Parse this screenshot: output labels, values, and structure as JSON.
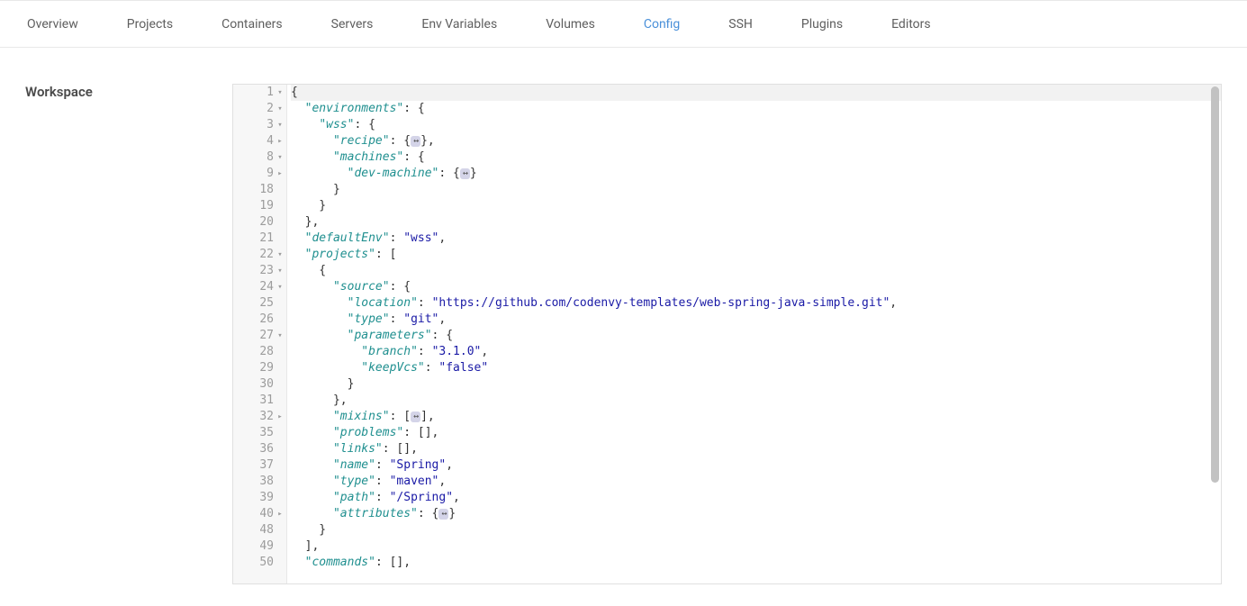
{
  "tabs": {
    "items": [
      {
        "label": "Overview",
        "active": false
      },
      {
        "label": "Projects",
        "active": false
      },
      {
        "label": "Containers",
        "active": false
      },
      {
        "label": "Servers",
        "active": false
      },
      {
        "label": "Env Variables",
        "active": false
      },
      {
        "label": "Volumes",
        "active": false
      },
      {
        "label": "Config",
        "active": true
      },
      {
        "label": "SSH",
        "active": false
      },
      {
        "label": "Plugins",
        "active": false
      },
      {
        "label": "Editors",
        "active": false
      }
    ]
  },
  "sidebar": {
    "section_label": "Workspace"
  },
  "editor": {
    "gutter": [
      {
        "n": "1",
        "fold": "▾"
      },
      {
        "n": "2",
        "fold": "▾"
      },
      {
        "n": "3",
        "fold": "▾"
      },
      {
        "n": "4",
        "fold": "▸"
      },
      {
        "n": "8",
        "fold": "▾"
      },
      {
        "n": "9",
        "fold": "▸"
      },
      {
        "n": "18",
        "fold": ""
      },
      {
        "n": "19",
        "fold": ""
      },
      {
        "n": "20",
        "fold": ""
      },
      {
        "n": "21",
        "fold": ""
      },
      {
        "n": "22",
        "fold": "▾"
      },
      {
        "n": "23",
        "fold": "▾"
      },
      {
        "n": "24",
        "fold": "▾"
      },
      {
        "n": "25",
        "fold": ""
      },
      {
        "n": "26",
        "fold": ""
      },
      {
        "n": "27",
        "fold": "▾"
      },
      {
        "n": "28",
        "fold": ""
      },
      {
        "n": "29",
        "fold": ""
      },
      {
        "n": "30",
        "fold": ""
      },
      {
        "n": "31",
        "fold": ""
      },
      {
        "n": "32",
        "fold": "▸"
      },
      {
        "n": "35",
        "fold": ""
      },
      {
        "n": "36",
        "fold": ""
      },
      {
        "n": "37",
        "fold": ""
      },
      {
        "n": "38",
        "fold": ""
      },
      {
        "n": "39",
        "fold": ""
      },
      {
        "n": "40",
        "fold": "▸"
      },
      {
        "n": "48",
        "fold": ""
      },
      {
        "n": "49",
        "fold": ""
      },
      {
        "n": "50",
        "fold": ""
      }
    ],
    "lines": [
      {
        "active": true,
        "tokens": [
          {
            "t": "pun",
            "v": "{"
          }
        ]
      },
      {
        "tokens": [
          {
            "t": "pun",
            "v": "  "
          },
          {
            "t": "key",
            "v": "\"environments\""
          },
          {
            "t": "pun",
            "v": ": {"
          }
        ]
      },
      {
        "tokens": [
          {
            "t": "pun",
            "v": "    "
          },
          {
            "t": "key",
            "v": "\"wss\""
          },
          {
            "t": "pun",
            "v": ": {"
          }
        ]
      },
      {
        "tokens": [
          {
            "t": "pun",
            "v": "      "
          },
          {
            "t": "key",
            "v": "\"recipe\""
          },
          {
            "t": "pun",
            "v": ": {"
          },
          {
            "t": "fold",
            "v": "↔"
          },
          {
            "t": "pun",
            "v": "},"
          }
        ]
      },
      {
        "tokens": [
          {
            "t": "pun",
            "v": "      "
          },
          {
            "t": "key",
            "v": "\"machines\""
          },
          {
            "t": "pun",
            "v": ": {"
          }
        ]
      },
      {
        "tokens": [
          {
            "t": "pun",
            "v": "        "
          },
          {
            "t": "key",
            "v": "\"dev-machine\""
          },
          {
            "t": "pun",
            "v": ": {"
          },
          {
            "t": "fold",
            "v": "↔"
          },
          {
            "t": "pun",
            "v": "}"
          }
        ]
      },
      {
        "tokens": [
          {
            "t": "pun",
            "v": "      }"
          }
        ]
      },
      {
        "tokens": [
          {
            "t": "pun",
            "v": "    }"
          }
        ]
      },
      {
        "tokens": [
          {
            "t": "pun",
            "v": "  },"
          }
        ]
      },
      {
        "tokens": [
          {
            "t": "pun",
            "v": "  "
          },
          {
            "t": "key",
            "v": "\"defaultEnv\""
          },
          {
            "t": "pun",
            "v": ": "
          },
          {
            "t": "str",
            "v": "\"wss\""
          },
          {
            "t": "pun",
            "v": ","
          }
        ]
      },
      {
        "tokens": [
          {
            "t": "pun",
            "v": "  "
          },
          {
            "t": "key",
            "v": "\"projects\""
          },
          {
            "t": "pun",
            "v": ": ["
          }
        ]
      },
      {
        "tokens": [
          {
            "t": "pun",
            "v": "    {"
          }
        ]
      },
      {
        "tokens": [
          {
            "t": "pun",
            "v": "      "
          },
          {
            "t": "key",
            "v": "\"source\""
          },
          {
            "t": "pun",
            "v": ": {"
          }
        ]
      },
      {
        "tokens": [
          {
            "t": "pun",
            "v": "        "
          },
          {
            "t": "key",
            "v": "\"location\""
          },
          {
            "t": "pun",
            "v": ": "
          },
          {
            "t": "str",
            "v": "\"https://github.com/codenvy-templates/web-spring-java-simple.git\""
          },
          {
            "t": "pun",
            "v": ","
          }
        ]
      },
      {
        "tokens": [
          {
            "t": "pun",
            "v": "        "
          },
          {
            "t": "key",
            "v": "\"type\""
          },
          {
            "t": "pun",
            "v": ": "
          },
          {
            "t": "str",
            "v": "\"git\""
          },
          {
            "t": "pun",
            "v": ","
          }
        ]
      },
      {
        "tokens": [
          {
            "t": "pun",
            "v": "        "
          },
          {
            "t": "key",
            "v": "\"parameters\""
          },
          {
            "t": "pun",
            "v": ": {"
          }
        ]
      },
      {
        "tokens": [
          {
            "t": "pun",
            "v": "          "
          },
          {
            "t": "key",
            "v": "\"branch\""
          },
          {
            "t": "pun",
            "v": ": "
          },
          {
            "t": "str",
            "v": "\"3.1.0\""
          },
          {
            "t": "pun",
            "v": ","
          }
        ]
      },
      {
        "tokens": [
          {
            "t": "pun",
            "v": "          "
          },
          {
            "t": "key",
            "v": "\"keepVcs\""
          },
          {
            "t": "pun",
            "v": ": "
          },
          {
            "t": "str",
            "v": "\"false\""
          }
        ]
      },
      {
        "tokens": [
          {
            "t": "pun",
            "v": "        }"
          }
        ]
      },
      {
        "tokens": [
          {
            "t": "pun",
            "v": "      },"
          }
        ]
      },
      {
        "tokens": [
          {
            "t": "pun",
            "v": "      "
          },
          {
            "t": "key",
            "v": "\"mixins\""
          },
          {
            "t": "pun",
            "v": ": ["
          },
          {
            "t": "fold",
            "v": "↔"
          },
          {
            "t": "pun",
            "v": "],"
          }
        ]
      },
      {
        "tokens": [
          {
            "t": "pun",
            "v": "      "
          },
          {
            "t": "key",
            "v": "\"problems\""
          },
          {
            "t": "pun",
            "v": ": [],"
          }
        ]
      },
      {
        "tokens": [
          {
            "t": "pun",
            "v": "      "
          },
          {
            "t": "key",
            "v": "\"links\""
          },
          {
            "t": "pun",
            "v": ": [],"
          }
        ]
      },
      {
        "tokens": [
          {
            "t": "pun",
            "v": "      "
          },
          {
            "t": "key",
            "v": "\"name\""
          },
          {
            "t": "pun",
            "v": ": "
          },
          {
            "t": "str",
            "v": "\"Spring\""
          },
          {
            "t": "pun",
            "v": ","
          }
        ]
      },
      {
        "tokens": [
          {
            "t": "pun",
            "v": "      "
          },
          {
            "t": "key",
            "v": "\"type\""
          },
          {
            "t": "pun",
            "v": ": "
          },
          {
            "t": "str",
            "v": "\"maven\""
          },
          {
            "t": "pun",
            "v": ","
          }
        ]
      },
      {
        "tokens": [
          {
            "t": "pun",
            "v": "      "
          },
          {
            "t": "key",
            "v": "\"path\""
          },
          {
            "t": "pun",
            "v": ": "
          },
          {
            "t": "str",
            "v": "\"/Spring\""
          },
          {
            "t": "pun",
            "v": ","
          }
        ]
      },
      {
        "tokens": [
          {
            "t": "pun",
            "v": "      "
          },
          {
            "t": "key",
            "v": "\"attributes\""
          },
          {
            "t": "pun",
            "v": ": {"
          },
          {
            "t": "fold",
            "v": "↔"
          },
          {
            "t": "pun",
            "v": "}"
          }
        ]
      },
      {
        "tokens": [
          {
            "t": "pun",
            "v": "    }"
          }
        ]
      },
      {
        "tokens": [
          {
            "t": "pun",
            "v": "  ],"
          }
        ]
      },
      {
        "tokens": [
          {
            "t": "pun",
            "v": "  "
          },
          {
            "t": "key",
            "v": "\"commands\""
          },
          {
            "t": "pun",
            "v": ": [],"
          }
        ]
      }
    ]
  }
}
